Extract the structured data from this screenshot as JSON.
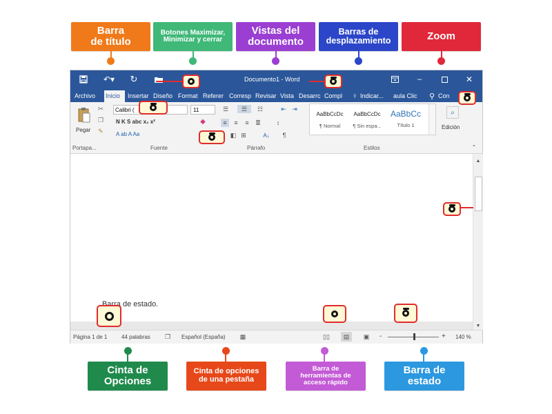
{
  "labels_top": [
    {
      "text": "Barra\nde título",
      "color": "#f07a1a"
    },
    {
      "text": "Botones Maximizar,\nMinimizar y cerrar",
      "color": "#3fb878"
    },
    {
      "text": "Vistas del\ndocumento",
      "color": "#9b3fd3"
    },
    {
      "text": "Barras de\ndesplazamiento",
      "color": "#2b46c8"
    },
    {
      "text": "Zoom",
      "color": "#e0283a"
    }
  ],
  "labels_bottom": [
    {
      "text": "Cinta de\nOpciones",
      "color": "#1f8a4c"
    },
    {
      "text": "Cinta de opciones\nde una pestaña",
      "color": "#e6481a"
    },
    {
      "text": "Barra de\nherramientas de\nacceso rápido",
      "color": "#c35ad6"
    },
    {
      "text": "Barra de\nestado",
      "color": "#2c98e0"
    }
  ],
  "window": {
    "title": "Documento1 - Word",
    "tabs": [
      "Archivo",
      "Inicio",
      "Insertar",
      "Diseño",
      "Format",
      "Referer",
      "Corresp",
      "Revisar",
      "Vista",
      "Desarrc",
      "Compl",
      "Indicar...",
      "aula Clic",
      "Con"
    ],
    "active_tab": "Inicio",
    "ribbon": {
      "paste_label": "Pegar",
      "font_name": "Calibri (",
      "font_size": "11",
      "font_format_row": "N  K  S  abc  x₂  x²",
      "font_effects_row": "A  ab  A  Aa",
      "styles": [
        {
          "preview": "AaBbCcDc",
          "name": "¶ Normal"
        },
        {
          "preview": "AaBbCcDc",
          "name": "¶ Sin espa..."
        },
        {
          "preview": "AaBbCc",
          "name": "Título 1"
        }
      ],
      "edicion_label": "Edición",
      "groups": [
        "Portapa...",
        "Fuente",
        "Párrafo",
        "Estilos"
      ]
    },
    "doc_fragment_text": "Barra de estado.",
    "status": {
      "page": "Página 1 de 1",
      "words": "44 palabras",
      "language": "Español (España)",
      "zoom_minus": "-",
      "zoom_plus": "+",
      "zoom_level": "140 %"
    }
  }
}
